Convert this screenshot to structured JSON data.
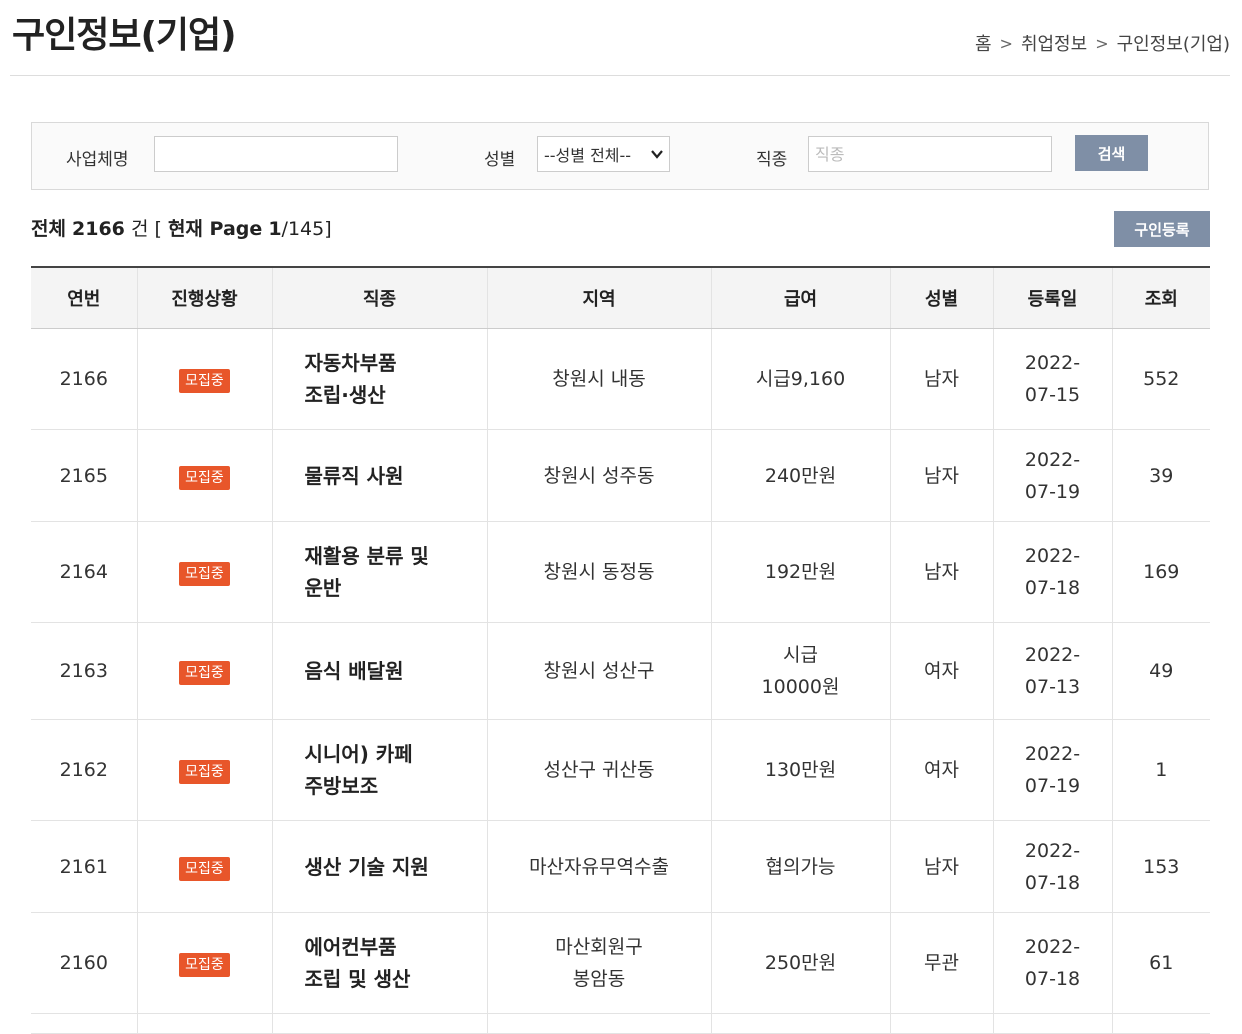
{
  "header": {
    "title": "구인정보(기업)",
    "breadcrumb": [
      "홈",
      "취업정보",
      "구인정보(기업)"
    ]
  },
  "search": {
    "company_label": "사업체명",
    "company_value": "",
    "gender_label": "성별",
    "gender_selected": "--성별 전체--",
    "job_label": "직종",
    "job_placeholder": "직종",
    "search_button": "검색"
  },
  "summary": {
    "total_label": "전체",
    "total": "2166",
    "unit": "건",
    "page_label": "현재 Page",
    "page": "1",
    "pages": "145"
  },
  "register_button": "구인등록",
  "colors": {
    "button": "#7f8fa6",
    "badge": "#e8562a"
  },
  "table": {
    "headers": [
      "연번",
      "진행상황",
      "직종",
      "지역",
      "급여",
      "성별",
      "등록일",
      "조회"
    ],
    "rows": [
      {
        "no": "2166",
        "status": "모집중",
        "job": "자동차부품\n조립·생산",
        "region": "창원시 내동",
        "pay": "시급9,160",
        "gender": "남자",
        "date": "2022-\n07-15",
        "views": "552"
      },
      {
        "no": "2165",
        "status": "모집중",
        "job": "물류직 사원",
        "region": "창원시 성주동",
        "pay": "240만원",
        "gender": "남자",
        "date": "2022-\n07-19",
        "views": "39"
      },
      {
        "no": "2164",
        "status": "모집중",
        "job": "재활용 분류 및\n운반",
        "region": "창원시 동정동",
        "pay": "192만원",
        "gender": "남자",
        "date": "2022-\n07-18",
        "views": "169"
      },
      {
        "no": "2163",
        "status": "모집중",
        "job": "음식 배달원",
        "region": "창원시 성산구",
        "pay": "시급\n10000원",
        "gender": "여자",
        "date": "2022-\n07-13",
        "views": "49"
      },
      {
        "no": "2162",
        "status": "모집중",
        "job": "시니어) 카페\n주방보조",
        "region": "성산구 귀산동",
        "pay": "130만원",
        "gender": "여자",
        "date": "2022-\n07-19",
        "views": "1"
      },
      {
        "no": "2161",
        "status": "모집중",
        "job": "생산 기술 지원",
        "region": "마산자유무역수출",
        "pay": "협의가능",
        "gender": "남자",
        "date": "2022-\n07-18",
        "views": "153"
      },
      {
        "no": "2160",
        "status": "모집중",
        "job": "에어컨부품\n조립 및 생산",
        "region": "마산회원구\n봉암동",
        "pay": "250만원",
        "gender": "무관",
        "date": "2022-\n07-18",
        "views": "61"
      }
    ]
  }
}
